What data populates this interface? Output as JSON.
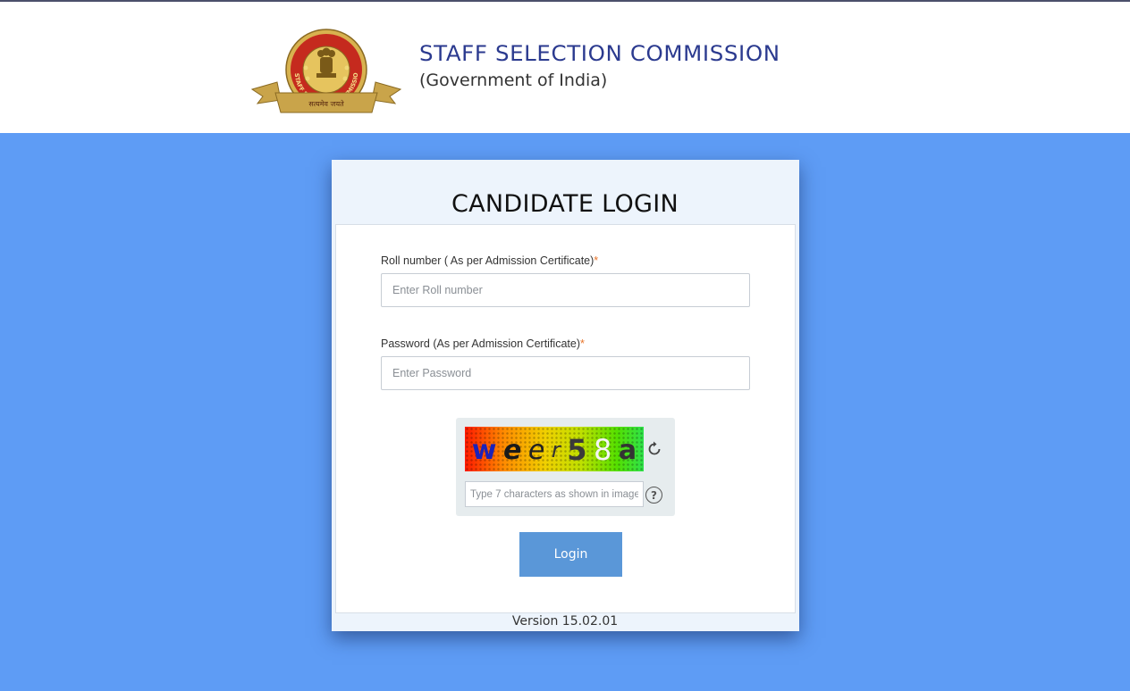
{
  "header": {
    "org_name": "STAFF SELECTION COMMISSION",
    "org_subtitle": "(Government of India)",
    "logo_ring_text": "STAFF SELECTION COMMISSION",
    "logo_ribbon_text": "सत्यमेव जयते"
  },
  "login": {
    "title": "CANDIDATE LOGIN",
    "roll_label": "Roll number ( As per Admission Certificate)",
    "roll_placeholder": "Enter Roll number",
    "password_label": "Password (As per Admission Certificate)",
    "password_placeholder": "Enter Password",
    "required_mark": "*",
    "captcha_chars": [
      "w",
      "e",
      "e",
      "r",
      "5",
      "8",
      "a"
    ],
    "captcha_placeholder": "Type 7 characters as shown in image",
    "help_symbol": "?",
    "login_button": "Login",
    "version": "Version 15.02.01"
  },
  "icons": {
    "refresh": "refresh-icon",
    "help": "help-icon"
  },
  "colors": {
    "page_background": "#5e9cf5",
    "title_blue": "#2b3a8f",
    "button": "#5a97d8",
    "required": "#e8742a"
  }
}
